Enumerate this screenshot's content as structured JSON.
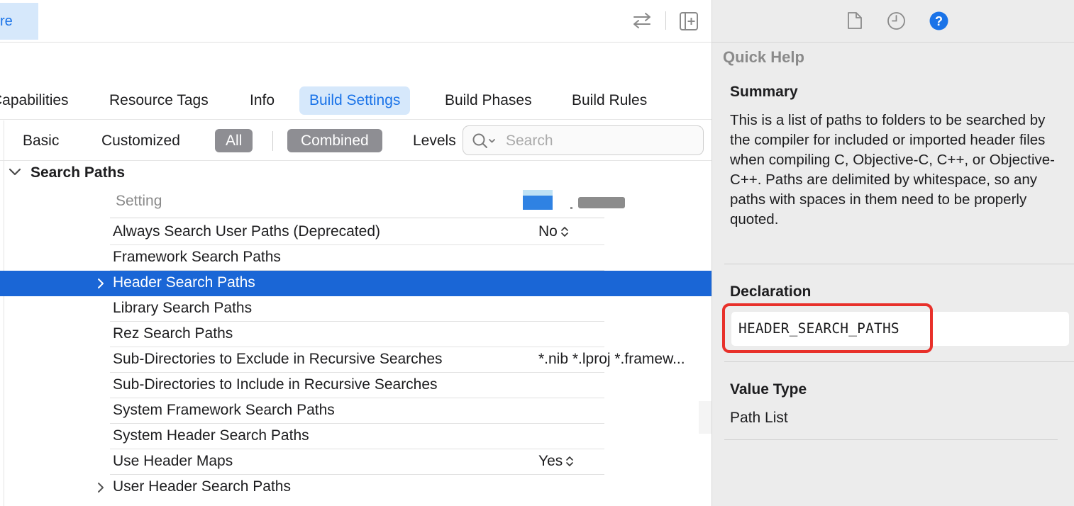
{
  "topbar": {
    "target_label": "re"
  },
  "tabs": [
    {
      "label": "Capabilities",
      "active": false
    },
    {
      "label": "Resource Tags",
      "active": false
    },
    {
      "label": "Info",
      "active": false
    },
    {
      "label": "Build Settings",
      "active": true
    },
    {
      "label": "Build Phases",
      "active": false
    },
    {
      "label": "Build Rules",
      "active": false
    }
  ],
  "filters": {
    "basic": "Basic",
    "customized": "Customized",
    "all": "All",
    "combined": "Combined",
    "levels": "Levels",
    "search_placeholder": "Search"
  },
  "section": {
    "title": "Search Paths",
    "column_setting": "Setting"
  },
  "rows": [
    {
      "label": "Always Search User Paths (Deprecated)",
      "value": "No",
      "stepper": true,
      "expandable": false,
      "selected": false
    },
    {
      "label": "Framework Search Paths",
      "value": "",
      "stepper": false,
      "expandable": false,
      "selected": false
    },
    {
      "label": "Header Search Paths",
      "value": "",
      "stepper": false,
      "expandable": true,
      "selected": true
    },
    {
      "label": "Library Search Paths",
      "value": "",
      "stepper": false,
      "expandable": false,
      "selected": false
    },
    {
      "label": "Rez Search Paths",
      "value": "",
      "stepper": false,
      "expandable": false,
      "selected": false
    },
    {
      "label": "Sub-Directories to Exclude in Recursive Searches",
      "value": "*.nib *.lproj *.framew...",
      "stepper": false,
      "expandable": false,
      "selected": false
    },
    {
      "label": "Sub-Directories to Include in Recursive Searches",
      "value": "",
      "stepper": false,
      "expandable": false,
      "selected": false
    },
    {
      "label": "System Framework Search Paths",
      "value": "",
      "stepper": false,
      "expandable": false,
      "selected": false
    },
    {
      "label": "System Header Search Paths",
      "value": "",
      "stepper": false,
      "expandable": false,
      "selected": false
    },
    {
      "label": "Use Header Maps",
      "value": "Yes",
      "stepper": true,
      "expandable": false,
      "selected": false
    },
    {
      "label": "User Header Search Paths",
      "value": "",
      "stepper": false,
      "expandable": true,
      "selected": false
    }
  ],
  "inspector": {
    "title": "Quick Help",
    "summary_heading": "Summary",
    "summary_text": "This is a list of paths to folders to be searched by the compiler for included or imported header files when compiling C, Objective-C, C++, or Objective-C++. Paths are delimited by whitespace, so any paths with spaces in them need to be properly quoted.",
    "declaration_heading": "Declaration",
    "declaration_value": "HEADER_SEARCH_PATHS",
    "value_type_heading": "Value Type",
    "value_type_value": "Path List"
  },
  "colors": {
    "accent": "#1a73e8",
    "selection": "#1a66d6",
    "tab_active_bg": "#d6e8fb",
    "pill_bg": "#8e8e93",
    "highlight": "#e8302a",
    "help_icon": "#1a73e8"
  },
  "icons": [
    "swap-arrows-icon",
    "add-editor-icon",
    "search-icon",
    "chevron-down-icon",
    "chevron-right-icon",
    "stepper-icon",
    "file-icon",
    "history-icon",
    "help-icon"
  ]
}
